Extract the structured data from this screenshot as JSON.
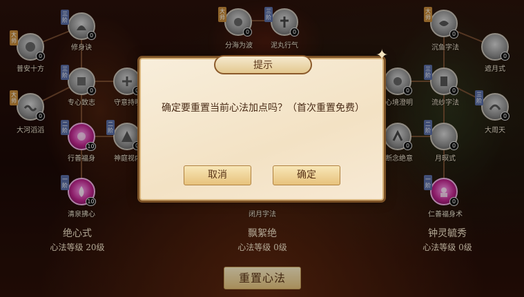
{
  "columns": [
    {
      "name": "绝心式",
      "level": "心法等级  20级"
    },
    {
      "name": "飘絮绝",
      "level": "心法等级  0级"
    },
    {
      "name": "钟灵毓秀",
      "level": "心法等级  0级"
    }
  ],
  "nodes": [
    {
      "label": "修身诀",
      "badge": "三阶",
      "level": "0"
    },
    {
      "label": "普安十方",
      "badge": "大师",
      "level": "0"
    },
    {
      "label": "专心致志",
      "badge": "三阶",
      "level": "0"
    },
    {
      "label": "守意持明",
      "badge": "",
      "level": "0"
    },
    {
      "label": "大河滔滔",
      "badge": "大师",
      "level": "0"
    },
    {
      "label": "行善福身",
      "badge": "二阶",
      "level": "10"
    },
    {
      "label": "神庭视内",
      "badge": "二阶",
      "level": "0"
    },
    {
      "label": "清泉拂心",
      "badge": "一阶",
      "level": "10"
    },
    {
      "label": "分海为波",
      "badge": "大师",
      "level": "0"
    },
    {
      "label": "泥丸行气",
      "badge": "三阶",
      "level": "0"
    },
    {
      "label": "闭月字法",
      "badge": "",
      "level": ""
    },
    {
      "label": "沉鱼字法",
      "badge": "大师",
      "level": "0"
    },
    {
      "label": "遮月式",
      "badge": "",
      "level": "0"
    },
    {
      "label": "心境澄明",
      "badge": "",
      "level": "0"
    },
    {
      "label": "流纱字法",
      "badge": "三阶",
      "level": "0"
    },
    {
      "label": "大周天",
      "badge": "三阶",
      "level": "0"
    },
    {
      "label": "断念绝意",
      "badge": "",
      "level": "0"
    },
    {
      "label": "月暝式",
      "badge": "二阶",
      "level": "0"
    },
    {
      "label": "仁善福身术",
      "badge": "一阶",
      "level": "0"
    }
  ],
  "dialog": {
    "title": "提示",
    "message": "确定要重置当前心法加点吗？（首次重置免费）",
    "cancel_label": "取消",
    "confirm_label": "确定"
  },
  "reset_button": "重置心法"
}
